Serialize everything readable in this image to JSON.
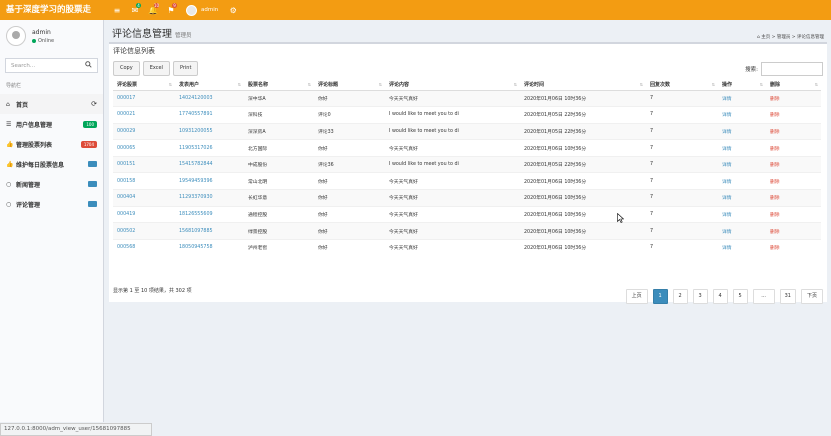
{
  "brand": "基于深度学习的股票走",
  "topbar": {
    "icons": [
      {
        "name": "menu-icon",
        "glyph": "≡",
        "badge": "",
        "badge_color": ""
      },
      {
        "name": "mail-icon",
        "glyph": "✉",
        "badge": "4",
        "badge_color": "#00a65a"
      },
      {
        "name": "bell-icon",
        "glyph": "🔔",
        "badge": "10",
        "badge_color": "#dd4b39"
      },
      {
        "name": "flag-icon",
        "glyph": "⚑",
        "badge": "9",
        "badge_color": "#dd4b39"
      }
    ],
    "user": "admin",
    "gear_glyph": "⚙"
  },
  "sidebar": {
    "user_name": "admin",
    "status": "Online",
    "search_placeholder": "Search...",
    "nav_header": "导航栏",
    "items": [
      {
        "label": "首页",
        "icon": "home-icon",
        "glyph": "⌂",
        "badge": "",
        "badge_color": "",
        "trail": "⟳"
      },
      {
        "label": "用户信息管理",
        "icon": "list-icon",
        "glyph": "☰",
        "badge": "100",
        "badge_color": "#00a65a"
      },
      {
        "label": "管理股票列表",
        "icon": "thumbs-up-icon",
        "glyph": "👍",
        "badge": "1704",
        "badge_color": "#dd4b39"
      },
      {
        "label": "维护每日股票信息",
        "icon": "thumbs-up-icon",
        "glyph": "👍",
        "badge": "",
        "badge_color": "#3c8dbc"
      },
      {
        "label": "新闻管理",
        "icon": "comment-icon",
        "glyph": "○",
        "badge": "",
        "badge_color": "#3c8dbc"
      },
      {
        "label": "评论管理",
        "icon": "comment-icon",
        "glyph": "○",
        "badge": "",
        "badge_color": "#3c8dbc"
      }
    ]
  },
  "header": {
    "title": "评论信息管理",
    "subtitle": "管理员",
    "breadcrumb": "⌂ 主页 > 管理员 > 评论信息管理"
  },
  "box": {
    "title": "评论信息列表",
    "buttons": [
      "Copy",
      "Excel",
      "Print"
    ],
    "search_label": "搜索:",
    "columns": [
      "评论股票",
      "发表用户",
      "股票名称",
      "评论标题",
      "评论内容",
      "评论时间",
      "回复次数",
      "操作",
      "删除"
    ],
    "rows": [
      [
        "000017",
        "14024120003",
        "深中华A",
        "你好",
        "今天天气真好",
        "2020年01月06日 10时36分",
        "7",
        "详情",
        "删除"
      ],
      [
        "000021",
        "17740557891",
        "深科技",
        "评论0",
        "I would like to meet you to di",
        "2020年01月05日 22时36分",
        "7",
        "详情",
        "删除"
      ],
      [
        "000029",
        "10931200055",
        "深深房A",
        "评论33",
        "I would like to meet you to di",
        "2020年01月05日 22时36分",
        "7",
        "详情",
        "删除"
      ],
      [
        "000065",
        "11905317026",
        "北方国际",
        "你好",
        "今天天气真好",
        "2020年01月06日 10时36分",
        "7",
        "详情",
        "删除"
      ],
      [
        "000151",
        "15415782844",
        "中成股份",
        "评论36",
        "I would like to meet you to di",
        "2020年01月05日 22时36分",
        "7",
        "详情",
        "删除"
      ],
      [
        "000158",
        "19549459396",
        "常山北明",
        "你好",
        "今天天气真好",
        "2020年01月06日 10时36分",
        "7",
        "详情",
        "删除"
      ],
      [
        "000404",
        "11293370930",
        "长虹华意",
        "你好",
        "今天天气真好",
        "2020年01月06日 10时36分",
        "7",
        "详情",
        "删除"
      ],
      [
        "000419",
        "18126555609",
        "通程控股",
        "你好",
        "今天天气真好",
        "2020年01月06日 10时36分",
        "7",
        "详情",
        "删除"
      ],
      [
        "000502",
        "15681097885",
        "绿景控股",
        "你好",
        "今天天气真好",
        "2020年01月06日 10时36分",
        "7",
        "详情",
        "删除"
      ],
      [
        "000568",
        "18050945758",
        "泸州老窖",
        "你好",
        "今天天气真好",
        "2020年01月06日 10时36分",
        "7",
        "详情",
        "删除"
      ]
    ],
    "info": "显示第 1 至 10 项结果，共 302 项",
    "pager": [
      "上页",
      "1",
      "2",
      "3",
      "4",
      "5",
      "...",
      "31",
      "下页"
    ],
    "current_page": "1"
  },
  "statusbar": "127.0.0.1:8000/adm_view_user/15681097885"
}
